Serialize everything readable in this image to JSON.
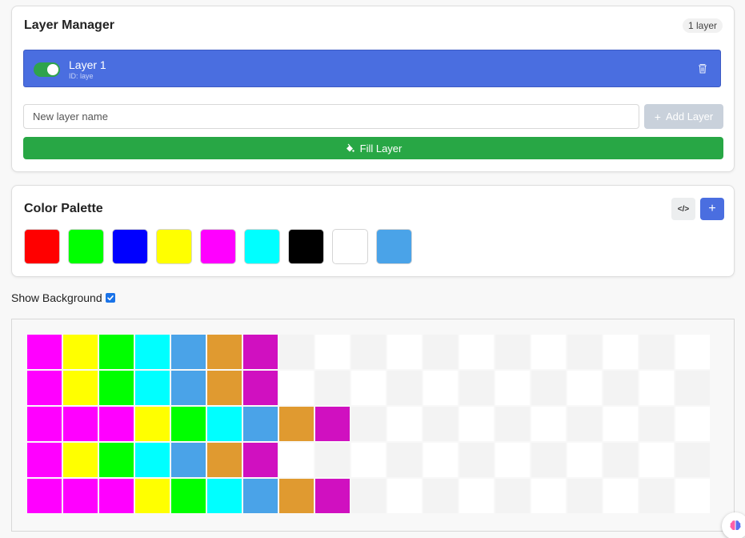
{
  "layer_manager": {
    "title": "Layer Manager",
    "layer_count": "1 layer",
    "layers": [
      {
        "name": "Layer 1",
        "id_text": "ID: laye",
        "visible": true
      }
    ],
    "new_layer_placeholder": "New layer name",
    "add_layer_label": "Add Layer",
    "fill_layer_label": "Fill Layer"
  },
  "palette": {
    "title": "Color Palette",
    "code_label": "</>",
    "add_label": "+",
    "colors": [
      "#ff0000",
      "#00ff00",
      "#0000ff",
      "#ffff00",
      "#ff00ff",
      "#00ffff",
      "#000000",
      "#ffffff",
      "#4aa3e8"
    ]
  },
  "show_background": {
    "label": "Show Background",
    "checked": true
  },
  "canvas": {
    "checker_light": "#ffffff",
    "checker_dark": "#f3f3f3",
    "columns": 19,
    "rows": [
      [
        "#ff00ff",
        "#ffff00",
        "#00ff00",
        "#00ffff",
        "#4aa3e8",
        "#e09a30",
        "#d010c0"
      ],
      [
        "#ff00ff",
        "#ffff00",
        "#00ff00",
        "#00ffff",
        "#4aa3e8",
        "#e09a30",
        "#d010c0"
      ],
      [
        "#ff00ff",
        "#ff00ff",
        "#ff00ff",
        "#ffff00",
        "#00ff00",
        "#00ffff",
        "#4aa3e8",
        "#e09a30",
        "#d010c0"
      ],
      [
        "#ff00ff",
        "#ffff00",
        "#00ff00",
        "#00ffff",
        "#4aa3e8",
        "#e09a30",
        "#d010c0"
      ],
      [
        "#ff00ff",
        "#ff00ff",
        "#ff00ff",
        "#ffff00",
        "#00ff00",
        "#00ffff",
        "#4aa3e8",
        "#e09a30",
        "#d010c0"
      ]
    ]
  }
}
